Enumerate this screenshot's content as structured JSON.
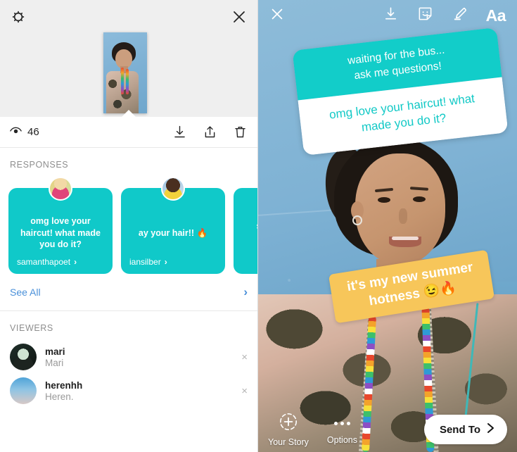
{
  "left_panel": {
    "header": {
      "settings_icon": "gear-icon",
      "close_icon": "close-icon"
    },
    "stats": {
      "view_icon": "eye-icon",
      "view_count": "46",
      "actions": [
        {
          "name": "download-icon",
          "label": "Download"
        },
        {
          "name": "share-icon",
          "label": "Share"
        },
        {
          "name": "trash-icon",
          "label": "Delete"
        }
      ]
    },
    "responses": {
      "section_label": "RESPONSES",
      "cards": [
        {
          "text": "omg love your haircut! what made you do it?",
          "username": "samanthapoet",
          "chevron": "›"
        },
        {
          "text": "ay your hair!! 🔥",
          "username": "iansilber",
          "chevron": "›"
        },
        {
          "text": "sam\nte\ns",
          "username": "",
          "chevron": ""
        }
      ],
      "see_all_label": "See All",
      "see_all_chevron": "›"
    },
    "viewers": {
      "section_label": "VIEWERS",
      "rows": [
        {
          "username": "mari",
          "fullname": "Mari",
          "remove_icon": "×"
        },
        {
          "username": "herenhh",
          "fullname": "Heren.",
          "remove_icon": "×"
        }
      ]
    }
  },
  "right_panel": {
    "top_bar": {
      "close_icon": "close-icon",
      "download_icon": "download-icon",
      "sticker_icon": "sticker-smiley-icon",
      "draw_icon": "marker-pen-icon",
      "text_label": "Aa"
    },
    "question_sticker": {
      "prompt_line1": "waiting for the bus...",
      "prompt_line2": "ask me questions!",
      "answer_line1": "omg love your haircut! what",
      "answer_line2": "made you do it?",
      "header_color": "#12cdc9",
      "body_text_color": "#11c9c6"
    },
    "orange_sticker": {
      "line1": "it's my new summer",
      "line2": "hotness 😉🔥",
      "color": "#f7c65a"
    },
    "bottom_bar": {
      "your_story_label": "Your Story",
      "your_story_icon": "add-circle-icon",
      "options_label": "Options",
      "options_icon": "more-dots-icon",
      "send_to_label": "Send To",
      "send_to_chevron": "›"
    }
  }
}
